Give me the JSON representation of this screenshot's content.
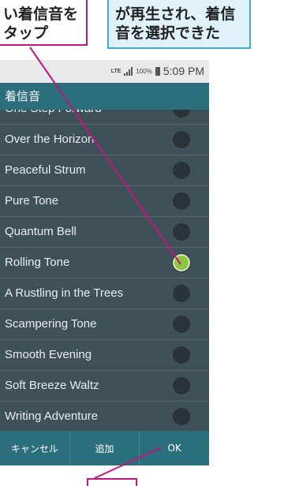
{
  "callouts": {
    "left_line1": "い着信音を",
    "left_line2": "タップ",
    "right_line1": "が再生され、着信",
    "right_line2": "音を選択できた"
  },
  "status": {
    "network": "LTE",
    "battery": "100%",
    "time": "5:09 PM"
  },
  "dialog": {
    "title": "着信音",
    "items": [
      {
        "label": "One Step Forward",
        "selected": false
      },
      {
        "label": "Over the Horizon",
        "selected": false
      },
      {
        "label": "Peaceful Strum",
        "selected": false
      },
      {
        "label": "Pure Tone",
        "selected": false
      },
      {
        "label": "Quantum Bell",
        "selected": false
      },
      {
        "label": "Rolling Tone",
        "selected": true
      },
      {
        "label": "A Rustling in the Trees",
        "selected": false
      },
      {
        "label": "Scampering Tone",
        "selected": false
      },
      {
        "label": "Smooth Evening",
        "selected": false
      },
      {
        "label": "Soft Breeze Waltz",
        "selected": false
      },
      {
        "label": "Writing Adventure",
        "selected": false
      }
    ],
    "buttons": {
      "cancel": "キャンセル",
      "add": "追加",
      "ok": "OK"
    }
  },
  "colors": {
    "title_bar": "#2b6f7c",
    "list_background": "#3e5058",
    "selected_radio": "#8ec63f",
    "callout_pink": "#c0157f",
    "callout_blue": "#4ba4d6"
  }
}
